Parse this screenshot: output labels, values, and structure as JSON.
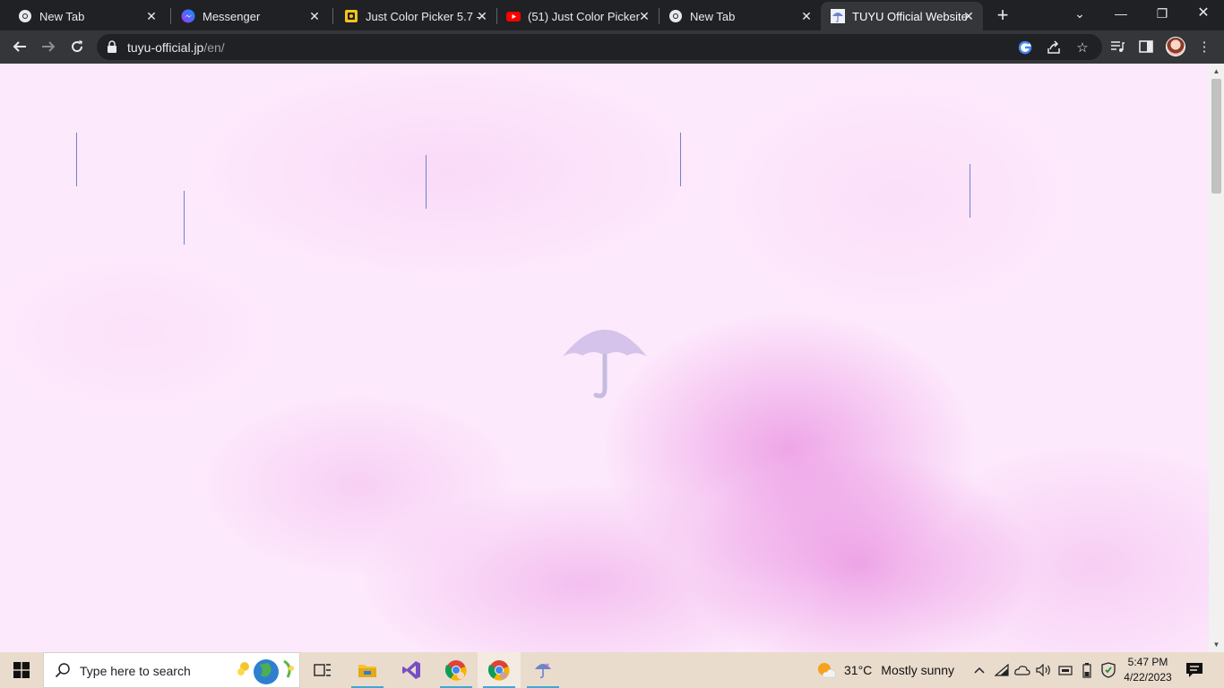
{
  "browser": {
    "tabs": [
      {
        "title": "New Tab",
        "icon": "chrome-icon"
      },
      {
        "title": "Messenger",
        "icon": "messenger-icon"
      },
      {
        "title": "Just Color Picker 5.7 -",
        "icon": "just-color-picker-icon"
      },
      {
        "title": "(51) Just Color Picker",
        "icon": "youtube-icon"
      },
      {
        "title": "New Tab",
        "icon": "chrome-icon"
      },
      {
        "title": "TUYU Official Website",
        "icon": "tuyu-umbrella-icon",
        "active": true
      }
    ],
    "url_host": "tuyu-official.jp",
    "url_path": "/en/"
  },
  "taskbar": {
    "search_placeholder": "Type here to search",
    "weather_temp": "31°C",
    "weather_condition": "Mostly sunny",
    "time": "5:47 PM",
    "date": "4/22/2023",
    "apps": [
      "task-view",
      "file-explorer",
      "visual-studio",
      "chrome",
      "chrome-profile",
      "tuyu-site"
    ]
  },
  "colors": {
    "page_background": "#fde9fc",
    "watercolor_accent": "#e26ed6",
    "rain_lines": "#6f83c8",
    "taskbar": "#e9dccd",
    "browser_frame": "#202124"
  }
}
